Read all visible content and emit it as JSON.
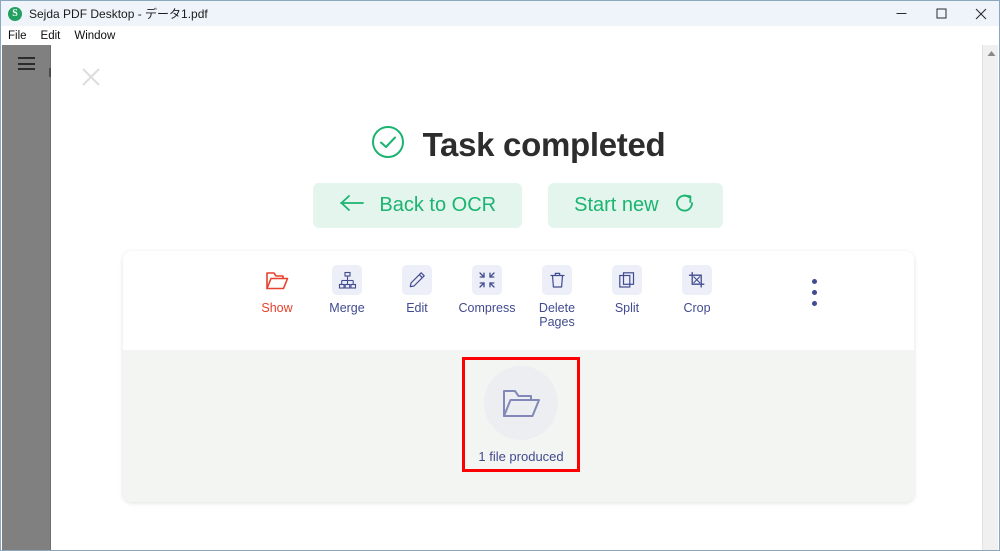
{
  "window": {
    "title": "Sejda PDF Desktop - データ1.pdf",
    "logo_letter": "S",
    "controls": {
      "minimize": "minimize-icon",
      "maximize": "maximize-icon",
      "close": "close-icon"
    }
  },
  "menubar": {
    "items": [
      {
        "label": "File"
      },
      {
        "label": "Edit"
      },
      {
        "label": "Window"
      }
    ]
  },
  "sidebar": {
    "menu_icon": "hamburger-icon"
  },
  "main": {
    "close_icon": "close-panel-icon",
    "status": {
      "icon": "check-circle-icon",
      "title": "Task completed"
    },
    "actions": [
      {
        "label": "Back to OCR",
        "icon": "arrow-left-icon",
        "icon_side": "left"
      },
      {
        "label": "Start new",
        "icon": "refresh-icon",
        "icon_side": "right"
      }
    ],
    "tools": [
      {
        "label": "Show",
        "icon": "open-folder-icon",
        "accent": true
      },
      {
        "label": "Merge",
        "icon": "merge-icon",
        "accent": false
      },
      {
        "label": "Edit",
        "icon": "pencil-icon",
        "accent": false
      },
      {
        "label": "Compress",
        "icon": "compress-icon",
        "accent": false
      },
      {
        "label": "Delete Pages",
        "icon": "trash-icon",
        "accent": false
      },
      {
        "label": "Split",
        "icon": "split-icon",
        "accent": false
      },
      {
        "label": "Crop",
        "icon": "crop-icon",
        "accent": false
      }
    ],
    "more_menu_icon": "more-vertical-icon",
    "result": {
      "icon": "open-folder-icon",
      "label": "1 file produced",
      "highlight_color": "#ff0000"
    }
  },
  "scrollbar": {
    "up_arrow_icon": "scroll-up-arrow-icon"
  },
  "colors": {
    "accent_green": "#1bb471",
    "accent_green_bg": "#e3f5ec",
    "tool_blue": "#414b8f",
    "tool_icon_bg": "#eceef8",
    "show_red": "#e8412d",
    "highlight_red": "#ff0000",
    "titlebar_bg": "#eef4fa",
    "sidebar_grey": "#808080",
    "card_bottom_grey": "#f3f5f3"
  }
}
